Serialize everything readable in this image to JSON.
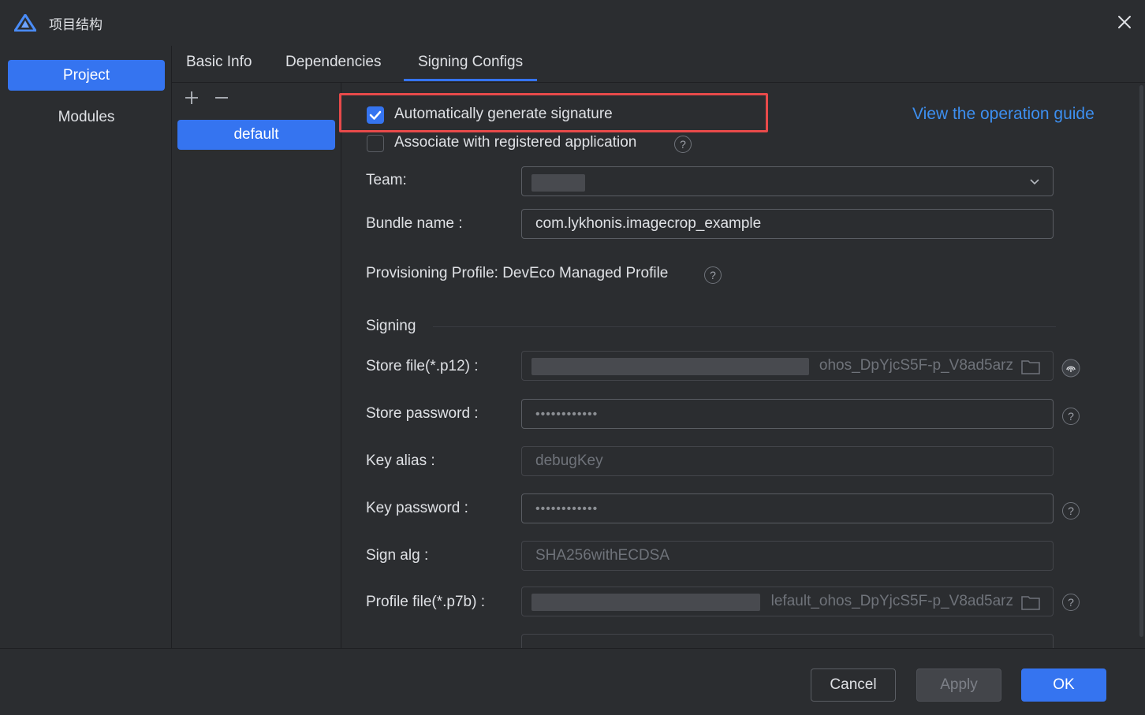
{
  "window": {
    "title": "项目结构",
    "close_icon": "close-icon"
  },
  "sidebar": {
    "items": [
      {
        "label": "Project",
        "active": true
      },
      {
        "label": "Modules",
        "active": false
      }
    ]
  },
  "tabs": [
    {
      "label": "Basic Info"
    },
    {
      "label": "Dependencies"
    },
    {
      "label": "Signing Configs",
      "active": true
    }
  ],
  "config_list": {
    "add_icon": "plus-icon",
    "remove_icon": "minus-icon",
    "items": [
      "default"
    ]
  },
  "signing": {
    "auto_generate": {
      "label": "Automatically generate signature",
      "checked": true
    },
    "associate": {
      "label": "Associate with registered application",
      "checked": false
    },
    "guide_link": "View the operation guide",
    "team": {
      "label": "Team:"
    },
    "bundle_name": {
      "label": "Bundle name",
      "sep": ":",
      "value": "com.lykhonis.imagecrop_example"
    },
    "provisioning": {
      "label": "Provisioning Profile: DevEco Managed Profile"
    },
    "section_title": "Signing",
    "store_file": {
      "label": "Store file(*.p12)",
      "sep": ":",
      "value": "ohos_DpYjcS5F-p_V8ad5arz"
    },
    "store_password": {
      "label": "Store password",
      "sep": ":",
      "value": "••••••••••••"
    },
    "key_alias": {
      "label": "Key alias",
      "sep": ":",
      "value": "debugKey"
    },
    "key_password": {
      "label": "Key password",
      "sep": ":",
      "value": "••••••••••••"
    },
    "sign_alg": {
      "label": "Sign alg",
      "sep": ":",
      "value": "SHA256withECDSA"
    },
    "profile_file": {
      "label": "Profile file(*.p7b)",
      "sep": ":",
      "value": "lefault_ohos_DpYjcS5F-p_V8ad5arz"
    }
  },
  "footer": {
    "cancel": "Cancel",
    "apply": "Apply",
    "ok": "OK"
  },
  "colors": {
    "accent": "#3574f0",
    "link": "#3d8ff0",
    "highlight": "#e84a4a",
    "background": "#2b2d30"
  },
  "help_glyph": "?"
}
